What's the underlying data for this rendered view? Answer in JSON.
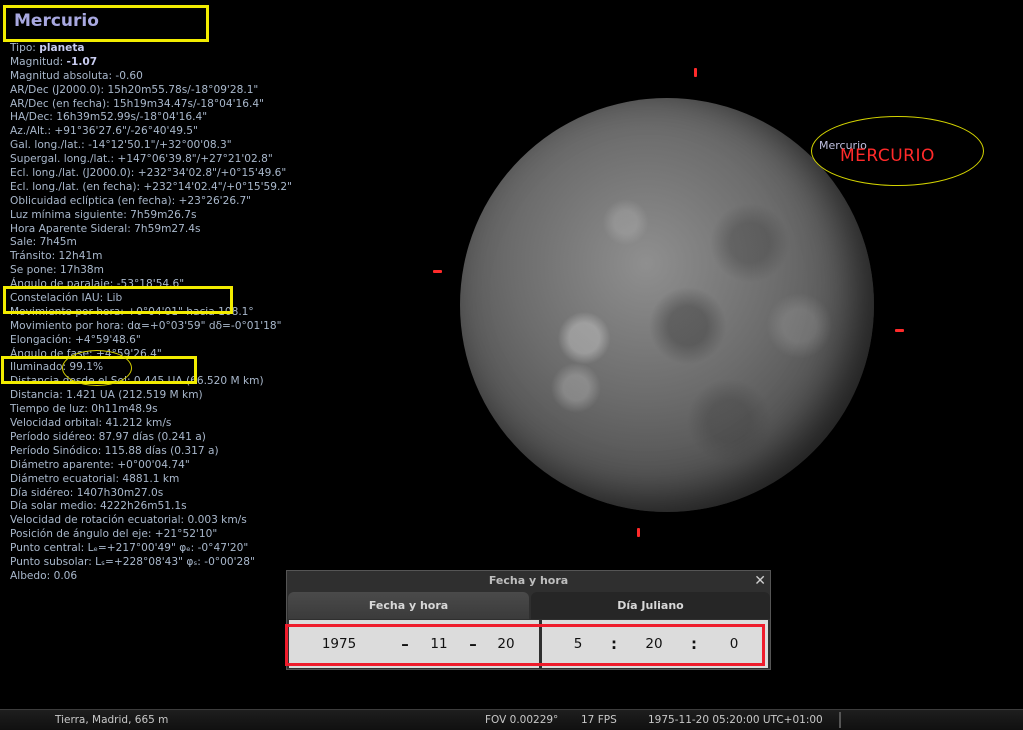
{
  "object": {
    "title": "Mercurio",
    "lines": [
      {
        "label": "Tipo: ",
        "value": "planeta",
        "bold": true
      },
      {
        "label": "Magnitud: ",
        "value": "-1.07",
        "bold": true
      },
      {
        "label": "Magnitud absoluta: -0.60"
      },
      {
        "label": "AR/Dec (J2000.0): 15h20m55.78s/-18°09'28.1\""
      },
      {
        "label": "AR/Dec (en fecha): 15h19m34.47s/-18°04'16.4\""
      },
      {
        "label": "HA/Dec: 16h39m52.99s/-18°04'16.4\""
      },
      {
        "label": "Az./Alt.: +91°36'27.6\"/-26°40'49.5\""
      },
      {
        "label": "Gal. long./lat.: -14°12'50.1\"/+32°00'08.3\""
      },
      {
        "label": "Supergal. long./lat.: +147°06'39.8\"/+27°21'02.8\""
      },
      {
        "label": "Ecl. long./lat. (J2000.0): +232°34'02.8\"/+0°15'49.6\""
      },
      {
        "label": "Ecl. long./lat. (en fecha): +232°14'02.4\"/+0°15'59.2\""
      },
      {
        "label": "Oblicuidad eclíptica (en fecha): +23°26'26.7\""
      },
      {
        "label": "Luz mínima siguiente: 7h59m26.7s"
      },
      {
        "label": "Hora Aparente Sideral: 7h59m27.4s"
      },
      {
        "label": "Sale: 7h45m"
      },
      {
        "label": "Tránsito: 12h41m"
      },
      {
        "label": "Se pone: 17h38m"
      },
      {
        "label": "Ángulo de paralaje: -53°18'54.6\""
      },
      {
        "label": "Constelación IAU: Lib"
      },
      {
        "label": "Movimiento por hora: +0°04'01\" hacia 108.1°"
      },
      {
        "label": "Movimiento por hora: dα=+0°03'59\" dδ=-0°01'18\""
      },
      {
        "label": "Elongación: +4°59'48.6\""
      },
      {
        "label": "Ángulo de fase: +4°59'26.4\""
      },
      {
        "label": "Iluminado: 99.1%"
      },
      {
        "label": "Distancia desde el Sol: 0.445 UA (66.520 M km)"
      },
      {
        "label": "Distancia: 1.421 UA (212.519 M km)"
      },
      {
        "label": "Tiempo de luz: 0h11m48.9s"
      },
      {
        "label": "Velocidad orbital: 41.212 km/s"
      },
      {
        "label": "Período sidéreo: 87.97 días (0.241 a)"
      },
      {
        "label": "Período Sinódico: 115.88 días (0.317 a)"
      },
      {
        "label": "Diámetro aparente: +0°00'04.74\""
      },
      {
        "label": "Diámetro ecuatorial: 4881.1 km"
      },
      {
        "label": "Día sidéreo: 1407h30m27.0s"
      },
      {
        "label": "Día solar medio: 4222h26m51.1s"
      },
      {
        "label": "Velocidad de rotación ecuatorial: 0.003 km/s"
      },
      {
        "label": "Posición de ángulo del eje: +21°52'10\""
      },
      {
        "label": "Punto central: Lₑ=+217°00'49\" φₑ: -0°47'20\""
      },
      {
        "label": "Punto subsolar: Lₛ=+228°08'43\" φₛ: -0°00'28\""
      },
      {
        "label": "Albedo: 0.06"
      }
    ]
  },
  "sky_label": {
    "small": "Mercurio",
    "big": "MERCURIO",
    "big_color": "#ff2a2a"
  },
  "dialog": {
    "title": "Fecha y hora",
    "tabs": [
      {
        "label": "Fecha y hora",
        "active": true
      },
      {
        "label": "Día Juliano",
        "active": false
      }
    ],
    "date": {
      "year": "1975",
      "month": "11",
      "day": "20",
      "sep": "–"
    },
    "time": {
      "hour": "5",
      "minute": "20",
      "second": "0",
      "sep": ":"
    }
  },
  "statusbar": {
    "location": "Tierra, Madrid, 665 m",
    "fov": "FOV 0.00229°",
    "fps": "17 FPS",
    "datetime": "1975-11-20 05:20:00 UTC+01:00"
  },
  "colors": {
    "highlight_yellow": "#f2ec00",
    "highlight_red": "#ef1c2c",
    "marker_red": "#ff2a2a"
  }
}
